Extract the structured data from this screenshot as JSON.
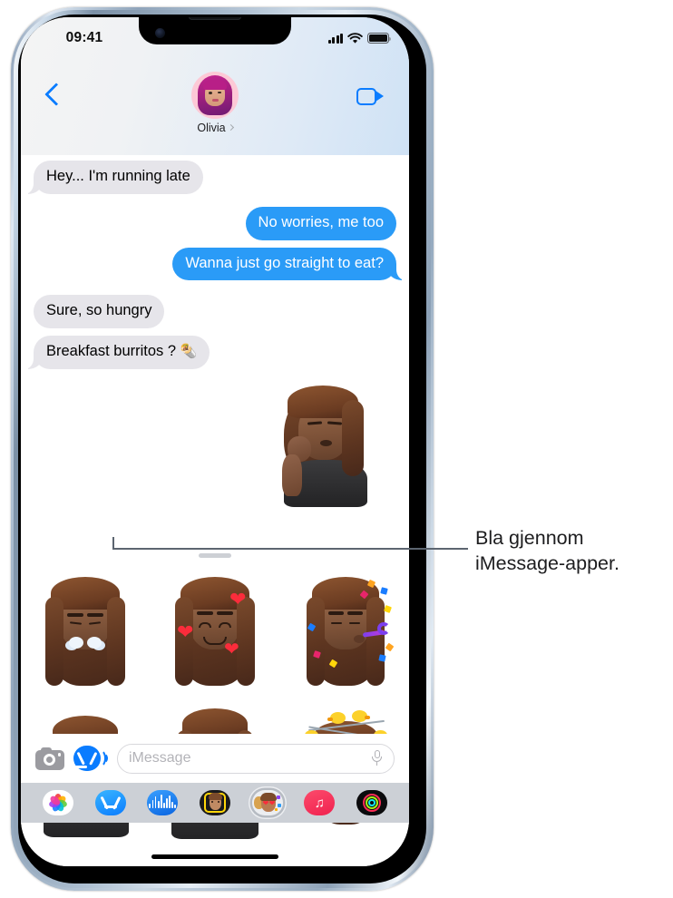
{
  "statusbar": {
    "time": "09:41",
    "signal_icon": "cellular-bars-icon",
    "wifi_icon": "wifi-icon",
    "battery_icon": "battery-icon"
  },
  "header": {
    "back_icon": "back-chevron-icon",
    "contact_name": "Olivia",
    "contact_chevron_icon": "chevron-right-icon",
    "avatar_icon": "memoji-avatar",
    "facetime_icon": "facetime-video-icon"
  },
  "conversation": {
    "messages": [
      {
        "text": "Hey... I'm running late",
        "direction": "in"
      },
      {
        "text": "No worries, me too",
        "direction": "out"
      },
      {
        "text": "Wanna just go straight to eat?",
        "direction": "out"
      },
      {
        "text": "Sure, so hungry",
        "direction": "in"
      },
      {
        "text": "Breakfast burritos ?",
        "direction": "in",
        "emoji": "🌯"
      }
    ],
    "sent_sticker_name": "memoji-chefs-kiss-sticker"
  },
  "inputbar": {
    "camera_icon": "camera-icon",
    "appstore_icon": "app-store-icon",
    "placeholder": "iMessage",
    "mic_icon": "microphone-icon"
  },
  "appdrawer": {
    "apps": [
      {
        "name": "photos-app-icon",
        "label": "Photos",
        "selected": false
      },
      {
        "name": "app-store-app-icon",
        "label": "App Store",
        "selected": false
      },
      {
        "name": "digital-touch-app-icon",
        "label": "Digital Touch",
        "selected": false
      },
      {
        "name": "memoji-app-icon",
        "label": "Memoji",
        "selected": false
      },
      {
        "name": "memoji-stickers-app-icon",
        "label": "Memoji Stickers",
        "selected": true
      },
      {
        "name": "music-app-icon",
        "label": "Music",
        "selected": false
      },
      {
        "name": "fitness-app-icon",
        "label": "Fitness",
        "selected": false
      }
    ]
  },
  "stickerpanel": {
    "grabber_icon": "drawer-grabber-handle",
    "stickers": [
      {
        "name": "memoji-sticker-steam-nose",
        "label": "Steam from nose"
      },
      {
        "name": "memoji-sticker-hearts",
        "label": "Smiling with hearts"
      },
      {
        "name": "memoji-sticker-party",
        "label": "Party horn"
      },
      {
        "name": "memoji-sticker-smirk",
        "label": "Smirking"
      },
      {
        "name": "memoji-sticker-yawn",
        "label": "Yawning"
      },
      {
        "name": "memoji-sticker-birds",
        "label": "Birds on head"
      }
    ],
    "home_indicator_icon": "home-indicator"
  },
  "callout": {
    "text": "Bla gjennom iMessage-apper."
  },
  "colors": {
    "accent_blue": "#0a7cff",
    "bubble_out": "#2a9bf7",
    "bubble_in": "#e6e5ea",
    "drawer_bg": "#ccd0d6",
    "callout_line": "#5c6570"
  }
}
